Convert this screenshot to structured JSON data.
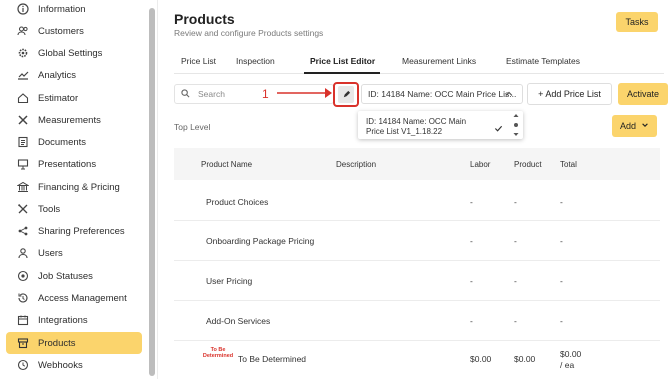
{
  "sidebar": {
    "items": [
      {
        "label": "Information",
        "icon": "info-icon"
      },
      {
        "label": "Customers",
        "icon": "users-icon"
      },
      {
        "label": "Global Settings",
        "icon": "gear-icon"
      },
      {
        "label": "Analytics",
        "icon": "chart-icon"
      },
      {
        "label": "Estimator",
        "icon": "home-icon"
      },
      {
        "label": "Measurements",
        "icon": "tools-cross-icon"
      },
      {
        "label": "Documents",
        "icon": "document-icon"
      },
      {
        "label": "Presentations",
        "icon": "presentation-icon"
      },
      {
        "label": "Financing & Pricing",
        "icon": "bank-icon"
      },
      {
        "label": "Tools",
        "icon": "wrench-icon"
      },
      {
        "label": "Sharing Preferences",
        "icon": "share-icon"
      },
      {
        "label": "Users",
        "icon": "user-icon"
      },
      {
        "label": "Job Statuses",
        "icon": "target-icon"
      },
      {
        "label": "Access Management",
        "icon": "history-icon"
      },
      {
        "label": "Integrations",
        "icon": "calendar-icon"
      },
      {
        "label": "Products",
        "icon": "box-icon"
      },
      {
        "label": "Webhooks",
        "icon": "webhook-icon"
      }
    ],
    "active_item": "Products",
    "active_color": "#fbd46c"
  },
  "header": {
    "title": "Products",
    "subtitle": "Review and configure Products settings",
    "tasks_label": "Tasks"
  },
  "tabs": [
    {
      "label": "Price List"
    },
    {
      "label": "Inspection"
    },
    {
      "label": "Price List Editor"
    },
    {
      "label": "Measurement Links"
    },
    {
      "label": "Estimate Templates"
    }
  ],
  "active_tab": "Price List Editor",
  "toolbar": {
    "search_placeholder": "Search",
    "selected_price_list": "ID: 14184 Name: OCC Main Price Lis...",
    "add_price_list_label": "+ Add Price List",
    "activate_label": "Activate"
  },
  "annotation": {
    "number": "1",
    "color": "#d9322b"
  },
  "dropdown": {
    "option_label": "ID: 14184 Name: OCC Main Price List V1_1.18.22"
  },
  "top_level_label": "Top Level",
  "add_button_label": "Add",
  "table": {
    "headers": [
      "Product Name",
      "Description",
      "Labor",
      "Product",
      "Total"
    ],
    "rows": [
      {
        "name": "Product Choices",
        "labor": "-",
        "product": "-",
        "total": "-"
      },
      {
        "name": "Onboarding Package Pricing",
        "labor": "-",
        "product": "-",
        "total": "-"
      },
      {
        "name": "User Pricing",
        "labor": "-",
        "product": "-",
        "total": "-"
      },
      {
        "name": "Add-On Services",
        "labor": "-",
        "product": "-",
        "total": "-"
      },
      {
        "name": "To Be Determined",
        "labor": "$0.00",
        "product": "$0.00",
        "total": "$0.00",
        "total_unit": "/ ea",
        "logo_text": "To Be Determined"
      }
    ]
  },
  "accent_color": "#fbd46c"
}
